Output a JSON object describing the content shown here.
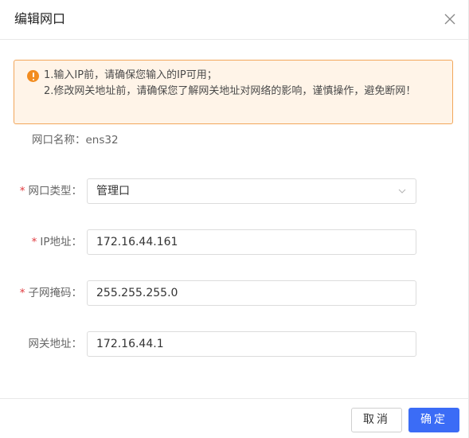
{
  "dialog": {
    "title": "编辑网口"
  },
  "alert": {
    "line1": "1.输入IP前，请确保您输入的IP可用；",
    "line2": "2.修改网关地址前，请确保您了解网关地址对网络的影响，谨慎操作，避免断网！",
    "icon": "warning-icon",
    "color": "#f28c1f"
  },
  "port_name": {
    "label": "网口名称：",
    "value": "ens32"
  },
  "form": {
    "port_type": {
      "label": "网口类型：",
      "value": "管理口",
      "required": "*"
    },
    "ip": {
      "label": "IP地址：",
      "value": "172.16.44.161",
      "required": "*"
    },
    "mask": {
      "label": "子网掩码：",
      "value": "255.255.255.0",
      "required": "*"
    },
    "gateway": {
      "label": "网关地址：",
      "value": "172.16.44.1"
    }
  },
  "footer": {
    "cancel_label": "取消",
    "ok_label": "确定"
  },
  "colors": {
    "primary": "#3b6cf6",
    "required": "#e0393e",
    "alert_border": "#f2a75b",
    "alert_bg": "#fff4e8"
  }
}
